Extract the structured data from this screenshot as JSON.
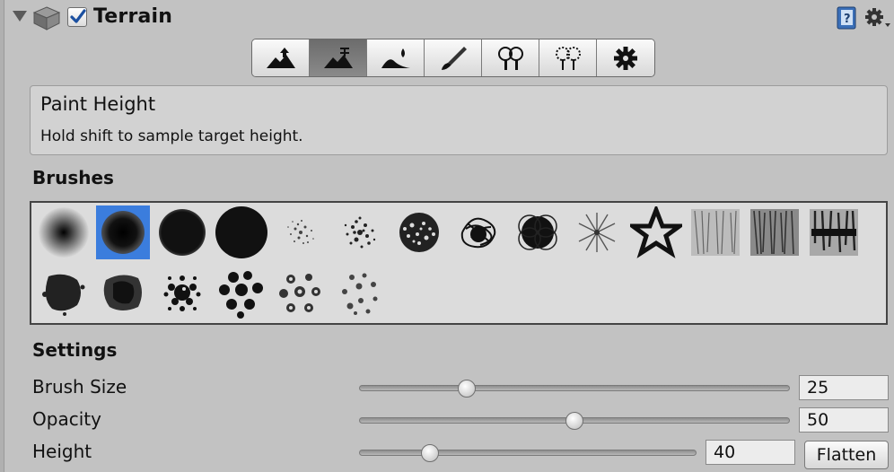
{
  "header": {
    "title": "Terrain",
    "enabled": true,
    "icons": [
      "foldout-arrow-icon",
      "terrain-cube-icon",
      "help-book-icon",
      "gear-icon"
    ]
  },
  "toolbar": {
    "tools": [
      {
        "name": "raise-lower-terrain-icon",
        "active": false
      },
      {
        "name": "paint-height-icon",
        "active": true
      },
      {
        "name": "smooth-height-icon",
        "active": false
      },
      {
        "name": "paint-texture-icon",
        "active": false
      },
      {
        "name": "place-trees-icon",
        "active": false
      },
      {
        "name": "paint-details-icon",
        "active": false
      },
      {
        "name": "terrain-settings-icon",
        "active": false
      }
    ]
  },
  "help": {
    "title": "Paint Height",
    "text": "Hold shift to sample target height."
  },
  "brushes": {
    "heading": "Brushes",
    "items": [
      "soft-round-brush",
      "medium-round-brush",
      "hard-round-brush",
      "solid-round-brush",
      "scatter-light-brush",
      "scatter-dense-brush",
      "speckle-brush",
      "scribble-brush",
      "ring-brush",
      "star-burst-brush",
      "star-outline-brush",
      "texture-light-brush",
      "texture-dense-brush",
      "texture-streak-brush",
      "splat-brush",
      "smudge-brush",
      "pebble-brush",
      "dots-brush",
      "lace-brush",
      "sparse-dots-brush"
    ],
    "selected_index": 1
  },
  "settings": {
    "heading": "Settings",
    "brush_size": {
      "label": "Brush Size",
      "value": "25",
      "fraction": 0.25
    },
    "opacity": {
      "label": "Opacity",
      "value": "50",
      "fraction": 0.5
    },
    "height": {
      "label": "Height",
      "value": "40",
      "fraction": 0.21
    },
    "flatten_label": "Flatten"
  },
  "colors": {
    "panel_bg": "#c2c2c2",
    "selection": "#3b7ddd"
  }
}
